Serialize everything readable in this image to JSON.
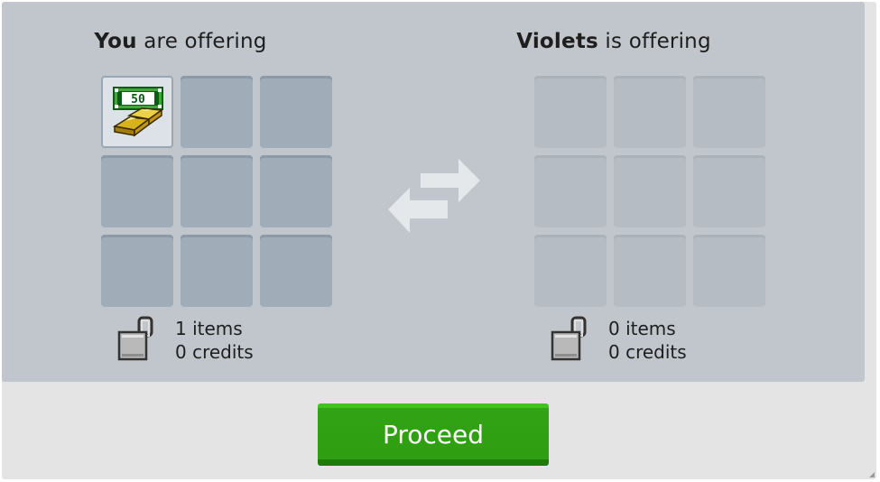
{
  "you": {
    "title_bold": "You",
    "title_rest": " are offering",
    "items_text": "1 items",
    "credits_text": "0 credits",
    "slots": [
      {
        "filled": true,
        "item_icon": "gold-bars-cash-icon",
        "item_label": "50"
      },
      {
        "filled": false
      },
      {
        "filled": false
      },
      {
        "filled": false
      },
      {
        "filled": false
      },
      {
        "filled": false
      },
      {
        "filled": false
      },
      {
        "filled": false
      },
      {
        "filled": false
      }
    ]
  },
  "partner": {
    "title_bold": "Violets",
    "title_rest": " is offering",
    "items_text": "0 items",
    "credits_text": "0 credits",
    "slots": [
      {
        "filled": false
      },
      {
        "filled": false
      },
      {
        "filled": false
      },
      {
        "filled": false
      },
      {
        "filled": false
      },
      {
        "filled": false
      },
      {
        "filled": false
      },
      {
        "filled": false
      },
      {
        "filled": false
      }
    ]
  },
  "swap_icon": "swap-arrows-icon",
  "lock_icon": "padlock-icon",
  "proceed_label": "Proceed",
  "colors": {
    "panel": "#c0c6cc",
    "window": "#e4e4e4",
    "proceed_button": "#31a314",
    "my_slot": "#a1acb9",
    "partner_slot": "#b5bcc4"
  }
}
